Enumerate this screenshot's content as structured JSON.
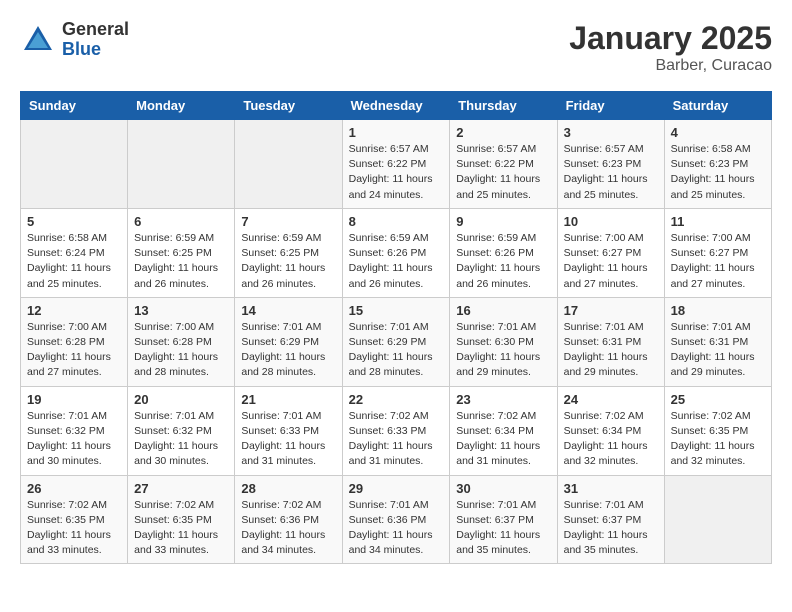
{
  "header": {
    "logo_general": "General",
    "logo_blue": "Blue",
    "title": "January 2025",
    "location": "Barber, Curacao"
  },
  "weekdays": [
    "Sunday",
    "Monday",
    "Tuesday",
    "Wednesday",
    "Thursday",
    "Friday",
    "Saturday"
  ],
  "weeks": [
    [
      {
        "day": "",
        "info": ""
      },
      {
        "day": "",
        "info": ""
      },
      {
        "day": "",
        "info": ""
      },
      {
        "day": "1",
        "info": "Sunrise: 6:57 AM\nSunset: 6:22 PM\nDaylight: 11 hours\nand 24 minutes."
      },
      {
        "day": "2",
        "info": "Sunrise: 6:57 AM\nSunset: 6:22 PM\nDaylight: 11 hours\nand 25 minutes."
      },
      {
        "day": "3",
        "info": "Sunrise: 6:57 AM\nSunset: 6:23 PM\nDaylight: 11 hours\nand 25 minutes."
      },
      {
        "day": "4",
        "info": "Sunrise: 6:58 AM\nSunset: 6:23 PM\nDaylight: 11 hours\nand 25 minutes."
      }
    ],
    [
      {
        "day": "5",
        "info": "Sunrise: 6:58 AM\nSunset: 6:24 PM\nDaylight: 11 hours\nand 25 minutes."
      },
      {
        "day": "6",
        "info": "Sunrise: 6:59 AM\nSunset: 6:25 PM\nDaylight: 11 hours\nand 26 minutes."
      },
      {
        "day": "7",
        "info": "Sunrise: 6:59 AM\nSunset: 6:25 PM\nDaylight: 11 hours\nand 26 minutes."
      },
      {
        "day": "8",
        "info": "Sunrise: 6:59 AM\nSunset: 6:26 PM\nDaylight: 11 hours\nand 26 minutes."
      },
      {
        "day": "9",
        "info": "Sunrise: 6:59 AM\nSunset: 6:26 PM\nDaylight: 11 hours\nand 26 minutes."
      },
      {
        "day": "10",
        "info": "Sunrise: 7:00 AM\nSunset: 6:27 PM\nDaylight: 11 hours\nand 27 minutes."
      },
      {
        "day": "11",
        "info": "Sunrise: 7:00 AM\nSunset: 6:27 PM\nDaylight: 11 hours\nand 27 minutes."
      }
    ],
    [
      {
        "day": "12",
        "info": "Sunrise: 7:00 AM\nSunset: 6:28 PM\nDaylight: 11 hours\nand 27 minutes."
      },
      {
        "day": "13",
        "info": "Sunrise: 7:00 AM\nSunset: 6:28 PM\nDaylight: 11 hours\nand 28 minutes."
      },
      {
        "day": "14",
        "info": "Sunrise: 7:01 AM\nSunset: 6:29 PM\nDaylight: 11 hours\nand 28 minutes."
      },
      {
        "day": "15",
        "info": "Sunrise: 7:01 AM\nSunset: 6:29 PM\nDaylight: 11 hours\nand 28 minutes."
      },
      {
        "day": "16",
        "info": "Sunrise: 7:01 AM\nSunset: 6:30 PM\nDaylight: 11 hours\nand 29 minutes."
      },
      {
        "day": "17",
        "info": "Sunrise: 7:01 AM\nSunset: 6:31 PM\nDaylight: 11 hours\nand 29 minutes."
      },
      {
        "day": "18",
        "info": "Sunrise: 7:01 AM\nSunset: 6:31 PM\nDaylight: 11 hours\nand 29 minutes."
      }
    ],
    [
      {
        "day": "19",
        "info": "Sunrise: 7:01 AM\nSunset: 6:32 PM\nDaylight: 11 hours\nand 30 minutes."
      },
      {
        "day": "20",
        "info": "Sunrise: 7:01 AM\nSunset: 6:32 PM\nDaylight: 11 hours\nand 30 minutes."
      },
      {
        "day": "21",
        "info": "Sunrise: 7:01 AM\nSunset: 6:33 PM\nDaylight: 11 hours\nand 31 minutes."
      },
      {
        "day": "22",
        "info": "Sunrise: 7:02 AM\nSunset: 6:33 PM\nDaylight: 11 hours\nand 31 minutes."
      },
      {
        "day": "23",
        "info": "Sunrise: 7:02 AM\nSunset: 6:34 PM\nDaylight: 11 hours\nand 31 minutes."
      },
      {
        "day": "24",
        "info": "Sunrise: 7:02 AM\nSunset: 6:34 PM\nDaylight: 11 hours\nand 32 minutes."
      },
      {
        "day": "25",
        "info": "Sunrise: 7:02 AM\nSunset: 6:35 PM\nDaylight: 11 hours\nand 32 minutes."
      }
    ],
    [
      {
        "day": "26",
        "info": "Sunrise: 7:02 AM\nSunset: 6:35 PM\nDaylight: 11 hours\nand 33 minutes."
      },
      {
        "day": "27",
        "info": "Sunrise: 7:02 AM\nSunset: 6:35 PM\nDaylight: 11 hours\nand 33 minutes."
      },
      {
        "day": "28",
        "info": "Sunrise: 7:02 AM\nSunset: 6:36 PM\nDaylight: 11 hours\nand 34 minutes."
      },
      {
        "day": "29",
        "info": "Sunrise: 7:01 AM\nSunset: 6:36 PM\nDaylight: 11 hours\nand 34 minutes."
      },
      {
        "day": "30",
        "info": "Sunrise: 7:01 AM\nSunset: 6:37 PM\nDaylight: 11 hours\nand 35 minutes."
      },
      {
        "day": "31",
        "info": "Sunrise: 7:01 AM\nSunset: 6:37 PM\nDaylight: 11 hours\nand 35 minutes."
      },
      {
        "day": "",
        "info": ""
      }
    ]
  ]
}
